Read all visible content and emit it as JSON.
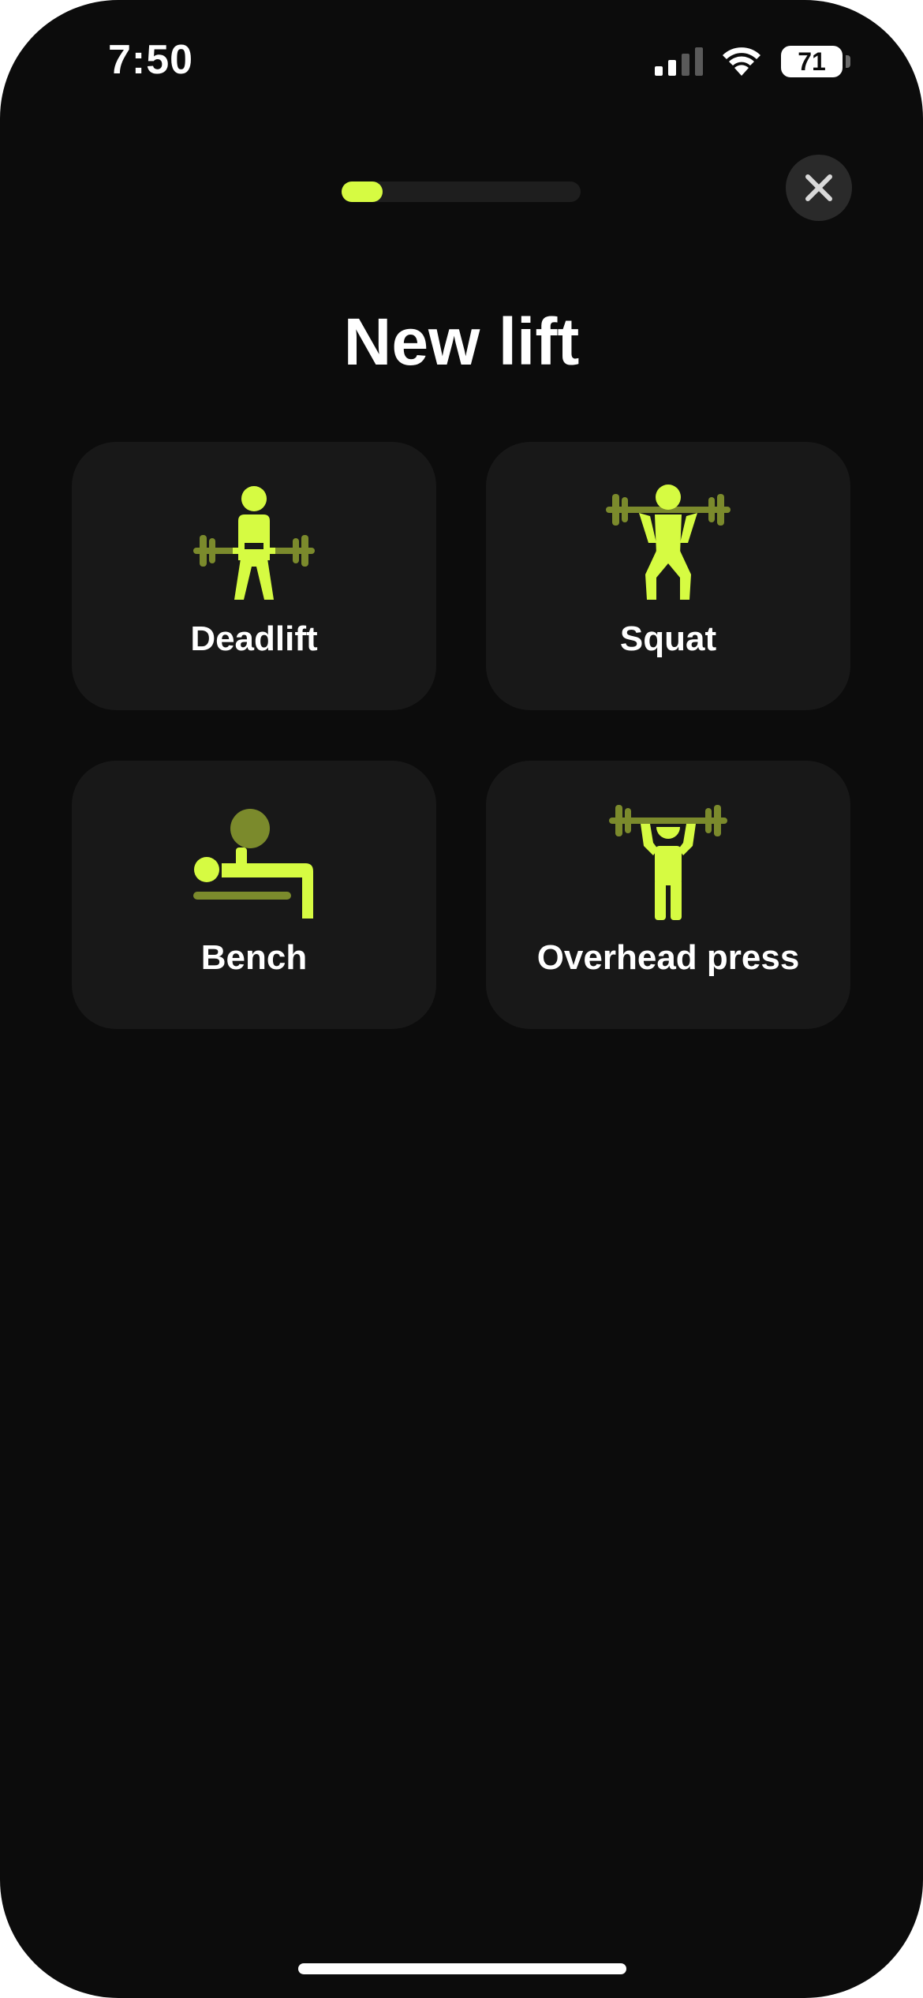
{
  "status_bar": {
    "time": "7:50",
    "battery": "71",
    "signal_icon": "cellular-signal-icon",
    "wifi_icon": "wifi-icon"
  },
  "progress": {
    "value": 0.17,
    "color": "#d6fb42"
  },
  "close_icon": "close-icon",
  "title": "New lift",
  "lifts": [
    {
      "label": "Deadlift",
      "icon": "deadlift-icon"
    },
    {
      "label": "Squat",
      "icon": "squat-icon"
    },
    {
      "label": "Bench",
      "icon": "bench-icon"
    },
    {
      "label": "Overhead press",
      "icon": "overhead-press-icon"
    }
  ],
  "colors": {
    "background": "#0c0c0c",
    "card": "#181818",
    "accent": "#d6fb42",
    "accent_dim": "#7b8a2c"
  }
}
